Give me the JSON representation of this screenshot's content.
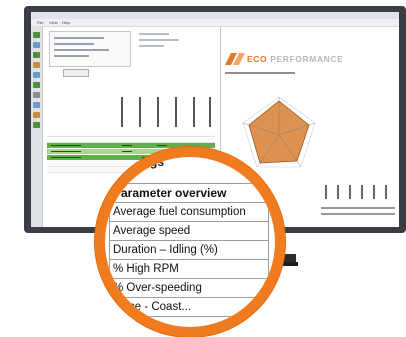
{
  "app": {
    "menu": [
      "File",
      "View",
      "Help"
    ]
  },
  "report": {
    "brand_prefix": "ECO",
    "brand_suffix": " PERFORMANCE"
  },
  "magnifier": {
    "top_text": "gs",
    "table_header": "Parameter overview",
    "rows": [
      "Average fuel consumption",
      "Average speed",
      "Duration – Idling (%)",
      "% High RPM",
      "% Over-speeding",
      "...nce - Coast..."
    ]
  },
  "colors": {
    "accent_orange": "#f07c1f",
    "table_green": "#62ad4e",
    "table_green_light": "#a7d68f",
    "radar_fill": "#d9863f"
  }
}
